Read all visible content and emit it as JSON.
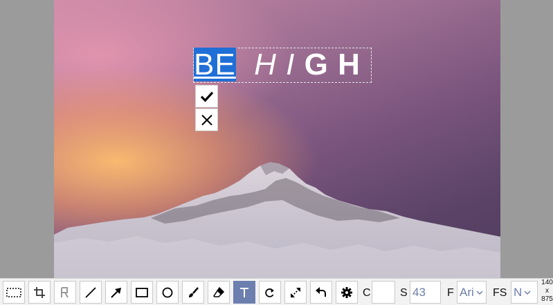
{
  "editor": {
    "text_selected": "BE",
    "text_rest_italic": "H I",
    "text_rest_bold": "G H"
  },
  "toolbar": {
    "tools": [
      {
        "name": "select-tool",
        "icon": "select-rect-icon"
      },
      {
        "name": "crop-tool",
        "icon": "crop-icon"
      },
      {
        "name": "pixelate-tool",
        "icon": "pixelate-icon"
      },
      {
        "name": "line-tool",
        "icon": "line-icon"
      },
      {
        "name": "arrow-tool",
        "icon": "arrow-icon"
      },
      {
        "name": "rectangle-tool",
        "icon": "rectangle-icon"
      },
      {
        "name": "ellipse-tool",
        "icon": "circle-icon"
      },
      {
        "name": "brush-tool",
        "icon": "brush-icon"
      },
      {
        "name": "eraser-tool",
        "icon": "eraser-icon"
      },
      {
        "name": "text-tool",
        "icon": "text-icon",
        "active": true
      },
      {
        "name": "rotate-tool",
        "icon": "rotate-icon"
      },
      {
        "name": "resize-tool",
        "icon": "resize-icon"
      },
      {
        "name": "undo-tool",
        "icon": "undo-icon"
      },
      {
        "name": "settings-tool",
        "icon": "gear-icon"
      }
    ],
    "color_label": "C",
    "color_value": "#ffffff",
    "size_label": "S",
    "size_value": "43",
    "font_label": "F",
    "font_value": "Ari",
    "font_style_label": "FS",
    "font_style_value": "N",
    "accent": "#6c7fae"
  },
  "image_size": {
    "width": "140",
    "x": "x",
    "height": "875"
  }
}
